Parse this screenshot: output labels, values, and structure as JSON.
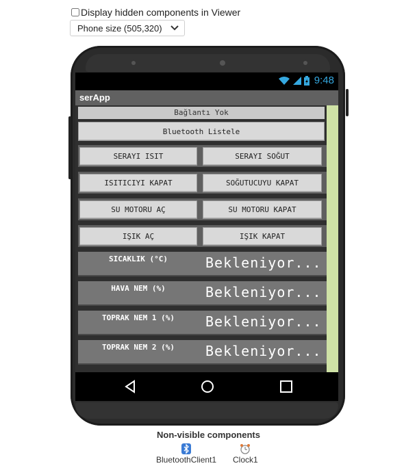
{
  "viewer": {
    "hidden_components_label": "Display hidden components in Viewer",
    "phone_size": "Phone size (505,320)"
  },
  "statusbar": {
    "time": "9:48"
  },
  "app": {
    "title": "serApp",
    "status_label": "Bağlantı Yok",
    "bluetooth_button": "Bluetooth Listele",
    "button_rows": [
      {
        "left": "SERAYI ISIT",
        "right": "SERAYI SOĞUT"
      },
      {
        "left": "ISITICIYI KAPAT",
        "right": "SOĞUTUCUYU KAPAT"
      },
      {
        "left": "SU MOTORU AÇ",
        "right": "SU MOTORU KAPAT"
      },
      {
        "left": "IŞIK AÇ",
        "right": "IŞIK KAPAT"
      }
    ],
    "sensors": [
      {
        "label": "SICAKLIK (°C)",
        "value": "Bekleniyor..."
      },
      {
        "label": "HAVA NEM (%)",
        "value": "Bekleniyor..."
      },
      {
        "label": "TOPRAK NEM 1 (%)",
        "value": "Bekleniyor..."
      },
      {
        "label": "TOPRAK NEM 2 (%)",
        "value": "Bekleniyor..."
      }
    ]
  },
  "nonvisible": {
    "title": "Non-visible components",
    "components": [
      {
        "name": "BluetoothClient1",
        "icon": "bluetooth-icon"
      },
      {
        "name": "Clock1",
        "icon": "clock-icon"
      }
    ]
  },
  "colors": {
    "scrollbar": "#cfe2a6",
    "status_accent": "#35a8e0",
    "titlebar": "#616161"
  }
}
